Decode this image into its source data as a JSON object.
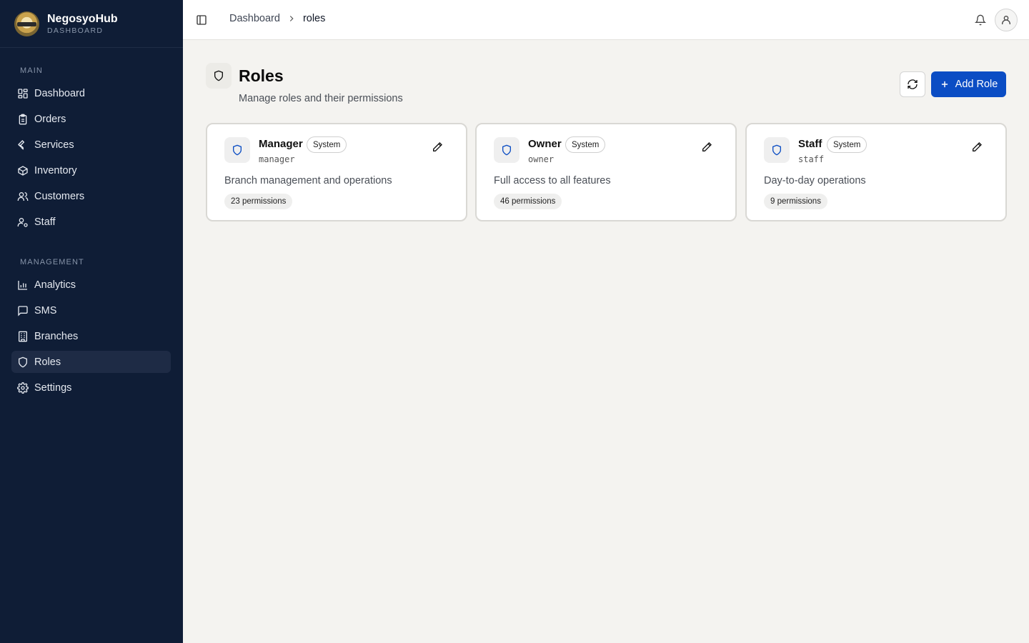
{
  "brand": {
    "name": "NegosyoHub",
    "subtitle": "DASHBOARD"
  },
  "sidebar": {
    "main_label": "MAIN",
    "management_label": "MANAGEMENT",
    "main_items": [
      {
        "label": "Dashboard",
        "icon": "dashboard-grid-icon"
      },
      {
        "label": "Orders",
        "icon": "clipboard-icon"
      },
      {
        "label": "Services",
        "icon": "wrench-icon"
      },
      {
        "label": "Inventory",
        "icon": "box-icon"
      },
      {
        "label": "Customers",
        "icon": "users-icon"
      },
      {
        "label": "Staff",
        "icon": "user-cog-icon"
      }
    ],
    "management_items": [
      {
        "label": "Analytics",
        "icon": "bar-chart-icon"
      },
      {
        "label": "SMS",
        "icon": "message-icon"
      },
      {
        "label": "Branches",
        "icon": "building-icon"
      },
      {
        "label": "Roles",
        "icon": "shield-icon",
        "active": true
      },
      {
        "label": "Settings",
        "icon": "gear-icon"
      }
    ]
  },
  "header": {
    "breadcrumb": [
      "Dashboard",
      "roles"
    ]
  },
  "page": {
    "title": "Roles",
    "subtitle": "Manage roles and their permissions",
    "add_button": "Add Role"
  },
  "roles": [
    {
      "name": "Manager",
      "badge": "System",
      "key": "manager",
      "description": "Branch management and operations",
      "permissions": "23 permissions"
    },
    {
      "name": "Owner",
      "badge": "System",
      "key": "owner",
      "description": "Full access to all features",
      "permissions": "46 permissions"
    },
    {
      "name": "Staff",
      "badge": "System",
      "key": "staff",
      "description": "Day-to-day operations",
      "permissions": "9 permissions"
    }
  ],
  "colors": {
    "sidebar_bg": "#0f1d36",
    "accent": "#0b4dc4",
    "page_bg": "#f4f3f0"
  }
}
